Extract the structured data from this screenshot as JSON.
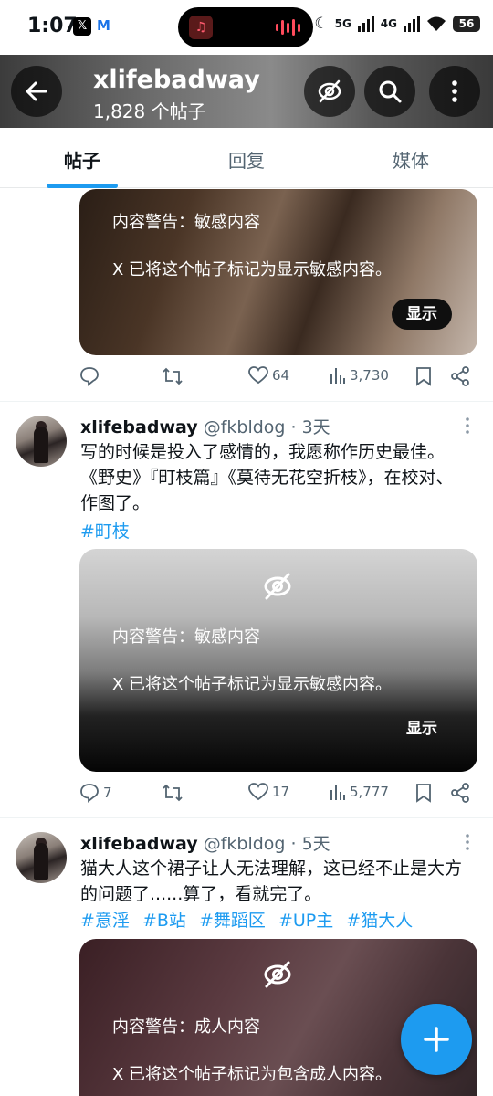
{
  "status_bar": {
    "time": "1:07",
    "x_app": "𝕏",
    "m_app": "M",
    "network_5g": "5G",
    "network_4g": "4G",
    "battery": "56"
  },
  "header": {
    "title": "xlifebadway",
    "subtitle": "1,828 个帖子"
  },
  "tabs": [
    {
      "label": "帖子",
      "active": true
    },
    {
      "label": "回复",
      "active": false
    },
    {
      "label": "媒体",
      "active": false
    }
  ],
  "posts": [
    {
      "media": {
        "warning_title": "内容警告：敏感内容",
        "warning_body": "X 已将这个帖子标记为显示敏感内容。",
        "show_label": "显示"
      },
      "stats": {
        "replies": "",
        "reposts": "",
        "likes": "64",
        "views": "3,730"
      }
    },
    {
      "author": "xlifebadway",
      "handle": "@fkbldog · 3天",
      "text": "写的时候是投入了感情的，我愿称作历史最佳。《野史》『町枝篇』《莫待无花空折枝》，在校对、作图了。",
      "tags": [
        "#町枝"
      ],
      "media": {
        "warning_title": "内容警告：敏感内容",
        "warning_body": "X 已将这个帖子标记为显示敏感内容。",
        "show_label": "显示"
      },
      "stats": {
        "replies": "7",
        "reposts": "",
        "likes": "17",
        "views": "5,777"
      }
    },
    {
      "author": "xlifebadway",
      "handle": "@fkbldog · 5天",
      "text": "猫大人这个裙子让人无法理解，这已经不止是大方的问题了......算了，看就完了。",
      "tags": [
        "#意淫",
        "#B站",
        "#舞蹈区",
        "#UP主",
        "#猫大人"
      ],
      "media": {
        "warning_title": "内容警告：成人内容",
        "warning_body": "X 已将这个帖子标记为包含成人内容。"
      }
    }
  ],
  "colors": {
    "accent": "#1d9bf0",
    "text": "#0f1419",
    "muted": "#536471"
  }
}
